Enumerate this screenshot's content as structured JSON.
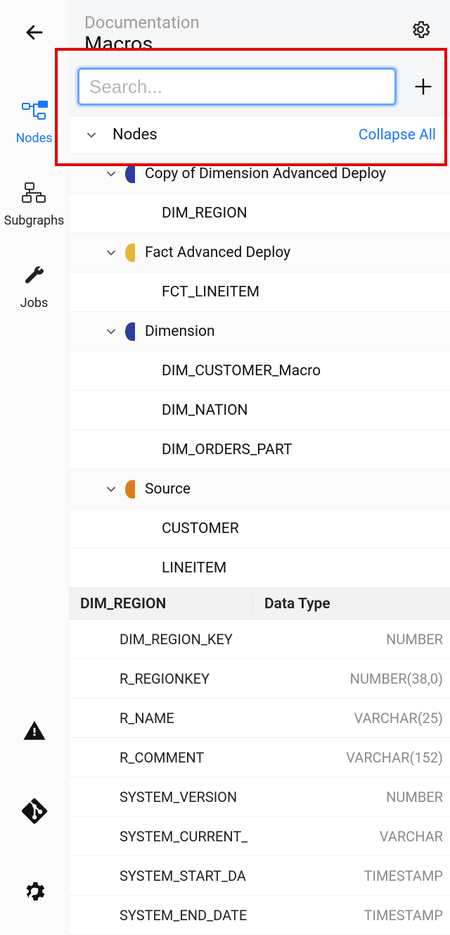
{
  "header": {
    "breadcrumb_parent": "Documentation",
    "title": "Macros"
  },
  "search": {
    "placeholder": "Search..."
  },
  "sidebar": {
    "items": [
      {
        "label": "Nodes"
      },
      {
        "label": "Subgraphs"
      },
      {
        "label": "Jobs"
      }
    ]
  },
  "panel": {
    "section_label": "Nodes",
    "collapse_all": "Collapse All"
  },
  "tree": [
    {
      "kind": "group",
      "label": "Copy of Dimension Advanced Deploy",
      "color": "#2b3e9e"
    },
    {
      "kind": "node",
      "label": "DIM_REGION"
    },
    {
      "kind": "group",
      "label": "Fact Advanced Deploy",
      "color": "#e4b63a"
    },
    {
      "kind": "node",
      "label": "FCT_LINEITEM"
    },
    {
      "kind": "group",
      "label": "Dimension",
      "color": "#2b3e9e"
    },
    {
      "kind": "node",
      "label": "DIM_CUSTOMER_Macro"
    },
    {
      "kind": "node",
      "label": "DIM_NATION"
    },
    {
      "kind": "node",
      "label": "DIM_ORDERS_PART"
    },
    {
      "kind": "group",
      "label": "Source",
      "color": "#e07b16"
    },
    {
      "kind": "node",
      "label": "CUSTOMER"
    },
    {
      "kind": "node",
      "label": "LINEITEM"
    }
  ],
  "columns_header": {
    "name": "DIM_REGION",
    "type": "Data Type"
  },
  "columns": [
    {
      "name": "DIM_REGION_KEY",
      "type": "NUMBER"
    },
    {
      "name": "R_REGIONKEY",
      "type": "NUMBER(38,0)"
    },
    {
      "name": "R_NAME",
      "type": "VARCHAR(25)"
    },
    {
      "name": "R_COMMENT",
      "type": "VARCHAR(152)"
    },
    {
      "name": "SYSTEM_VERSION",
      "type": "NUMBER"
    },
    {
      "name": "SYSTEM_CURRENT_",
      "type": "VARCHAR"
    },
    {
      "name": "SYSTEM_START_DA",
      "type": "TIMESTAMP"
    },
    {
      "name": "SYSTEM_END_DATE",
      "type": "TIMESTAMP"
    }
  ]
}
